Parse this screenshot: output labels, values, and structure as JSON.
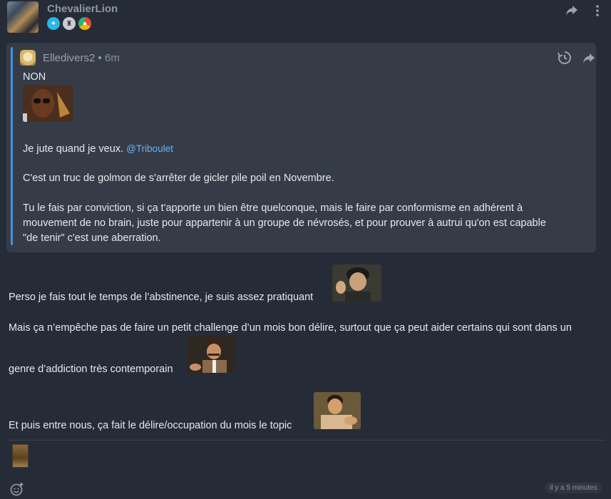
{
  "post": {
    "username": "ChevalierLion",
    "badges": [
      "star-badge",
      "award-badge",
      "loot-badge"
    ]
  },
  "quote": {
    "username": "Elledivers2",
    "separator": "•",
    "time": "6m",
    "line1": "NON",
    "line2_text": "Je jute quand je veux.",
    "line2_mention": "@Triboulet",
    "line3": "C'est un truc de golmon de s'arrêter de gicler pile poil en Novembre.",
    "line4a": "Tu le fais par conviction, si ça t'apporte un bien être quelconque, mais le faire par conformisme en adhérent à",
    "line4b": "mouvement de no brain, juste pour appartenir à un groupe de névrosés, et pour prouver à autrui qu'on est capable",
    "line4c": "\"de tenir\" c'est une aberration."
  },
  "body": {
    "p1": "Perso je fais tout le temps de l’abstinence, je suis assez pratiquant",
    "p2a": "Mais ça n’empêche pas de faire un petit challenge d’un mois bon délire, surtout que ça peut aider certains qui sont dans un",
    "p2b": "genre d’addiction très contemporain",
    "p3": "Et puis entre nous, ça fait le délire/occupation du mois le topic"
  },
  "footer": {
    "timestamp": "il y a 5 minutes"
  },
  "colors": {
    "background": "#262c37",
    "quote_background": "#353c48",
    "quote_accent": "#4a90d9",
    "mention": "#6db3f2"
  }
}
